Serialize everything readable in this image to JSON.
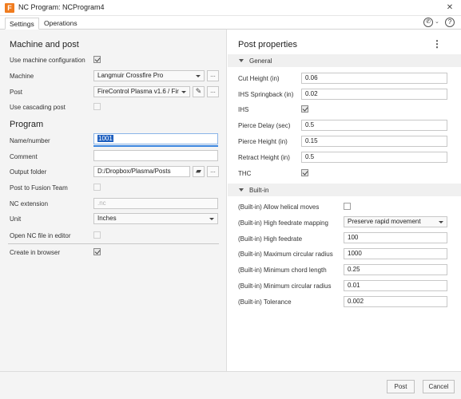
{
  "window": {
    "title": "NC Program: NCProgram4",
    "app_icon_letter": "F",
    "help_icon": "help-circle-icon",
    "close_icon": "close-icon"
  },
  "tabs": [
    {
      "label": "Settings",
      "active": true
    },
    {
      "label": "Operations",
      "active": false
    }
  ],
  "left": {
    "machine_section_title": "Machine and post",
    "use_machine_config": {
      "label": "Use machine configuration",
      "checked": true
    },
    "machine": {
      "label": "Machine",
      "value": "Langmuir Crossfire Pro",
      "more": "..."
    },
    "post": {
      "label": "Post",
      "value": "FireControl Plasma v1.6 / Fir",
      "more": "..."
    },
    "use_cascading_post": {
      "label": "Use cascading post",
      "checked": false
    },
    "program_section_title": "Program",
    "name_number": {
      "label": "Name/number",
      "value": "1001"
    },
    "comment": {
      "label": "Comment",
      "value": ""
    },
    "output_folder": {
      "label": "Output folder",
      "value": "D:/Dropbox/Plasma/Posts",
      "more": "..."
    },
    "post_to_fusion_team": {
      "label": "Post to Fusion Team",
      "checked": false
    },
    "nc_extension": {
      "label": "NC extension",
      "placeholder": ".nc"
    },
    "unit": {
      "label": "Unit",
      "value": "Inches"
    },
    "open_nc_file": {
      "label": "Open NC file in editor",
      "checked": false
    },
    "create_in_browser": {
      "label": "Create in browser",
      "checked": true
    }
  },
  "right": {
    "title": "Post properties",
    "more_icon": "vertical-ellipsis-icon",
    "general_title": "General",
    "general": [
      {
        "label": "Cut Height (in)",
        "value": "0.06"
      },
      {
        "label": "IHS Springback (in)",
        "value": "0.02"
      },
      {
        "label": "IHS",
        "checked": true
      },
      {
        "label": "Pierce Delay (sec)",
        "value": "0.5"
      },
      {
        "label": "Pierce Height (in)",
        "value": "0.15"
      },
      {
        "label": "Retract Height (in)",
        "value": "0.5"
      },
      {
        "label": "THC",
        "checked": true
      }
    ],
    "builtin_title": "Built-in",
    "builtin": [
      {
        "label": "(Built-in) Allow helical moves",
        "checked": false
      },
      {
        "label": "(Built-in) High feedrate mapping",
        "value": "Preserve rapid movement"
      },
      {
        "label": "(Built-in) High feedrate",
        "value": "100"
      },
      {
        "label": "(Built-in) Maximum circular radius",
        "value": "1000"
      },
      {
        "label": "(Built-in) Minimum chord length",
        "value": "0.25"
      },
      {
        "label": "(Built-in) Minimum circular radius",
        "value": "0.01"
      },
      {
        "label": "(Built-in) Tolerance",
        "value": "0.002"
      }
    ]
  },
  "footer": {
    "post_label": "Post",
    "cancel_label": "Cancel"
  }
}
